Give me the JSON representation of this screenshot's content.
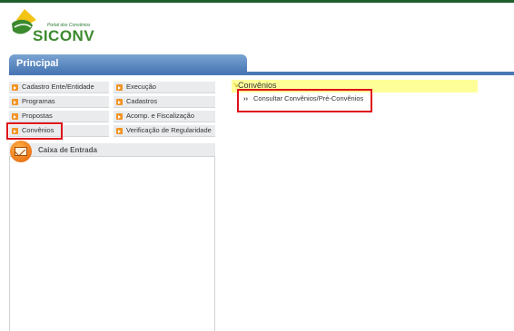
{
  "logo": {
    "subtitle": "Portal dos Convênios",
    "brand": "SICONV"
  },
  "principal": {
    "title": "Principal"
  },
  "menu": {
    "col1": [
      "Cadastro Ente/Entidade",
      "Programas",
      "Propostas",
      "Convênios"
    ],
    "col2": [
      "Execução",
      "Cadastros",
      "Acomp. e Fiscalização",
      "Verificação de Regularidade"
    ]
  },
  "inbox": {
    "title": "Caixa de Entrada"
  },
  "convenios_panel": {
    "title": "Convênios",
    "items": [
      {
        "bullet": "››",
        "label": "Consultar Convênios/Pré-Convênios"
      }
    ]
  },
  "colors": {
    "highlight": "#e0101a",
    "principal_bar": "#4a78b5",
    "menu_icon": "#f29322",
    "submenu_header": "#ffff99",
    "brand_green": "#3c8a2e"
  }
}
